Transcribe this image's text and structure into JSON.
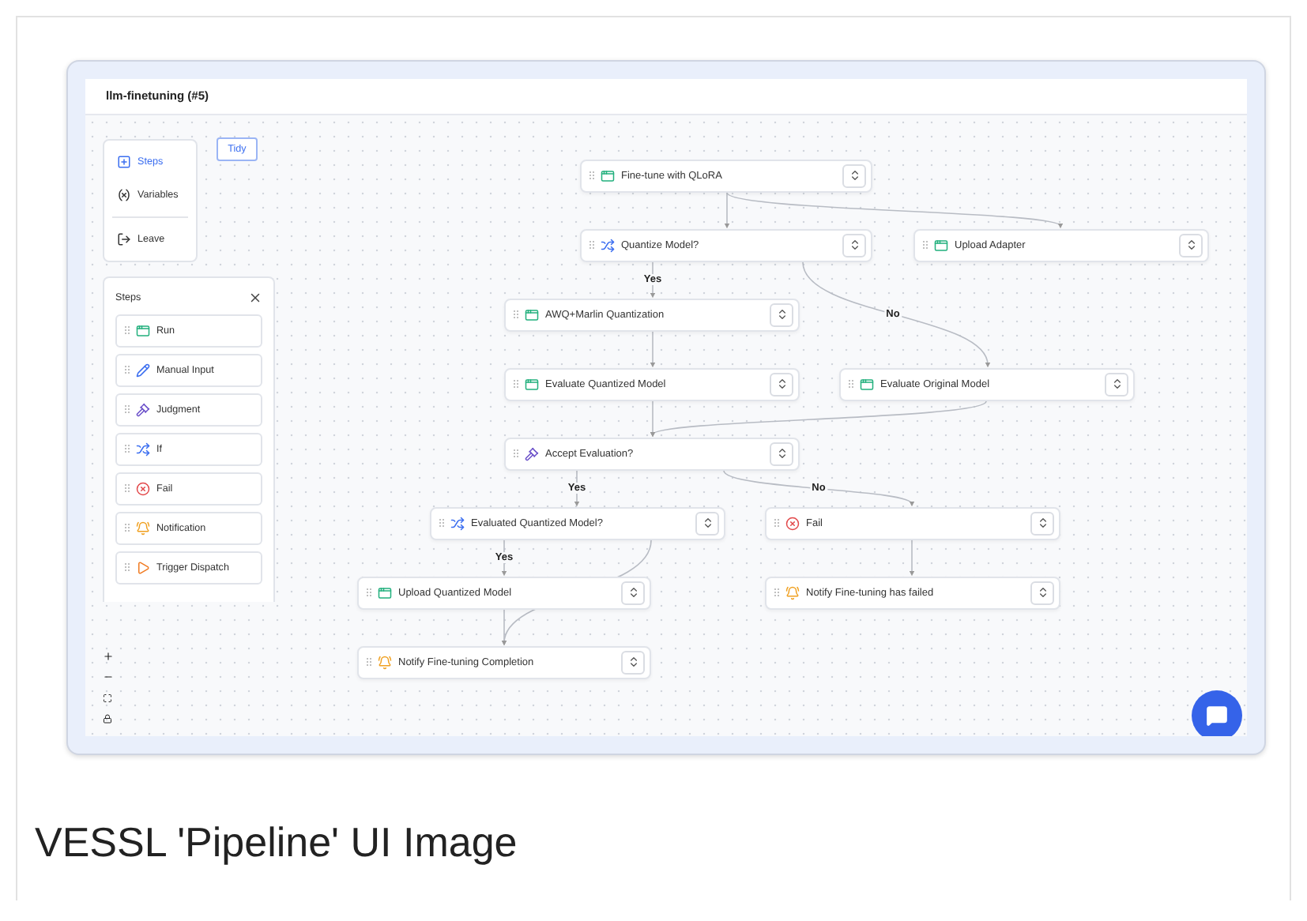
{
  "window": {
    "title": "llm-finetuning (#5)"
  },
  "menu": [
    {
      "label": "Steps",
      "kind": "steps",
      "selected": true
    },
    {
      "label": "Variables",
      "kind": "variables",
      "selected": false
    },
    {
      "label": "Leave",
      "kind": "leave",
      "selected": false
    }
  ],
  "tidy_button": "Tidy",
  "steps_panel": {
    "title": "Steps",
    "items": [
      {
        "label": "Run",
        "kind": "run"
      },
      {
        "label": "Manual Input",
        "kind": "input"
      },
      {
        "label": "Judgment",
        "kind": "judgment"
      },
      {
        "label": "If",
        "kind": "if"
      },
      {
        "label": "Fail",
        "kind": "fail"
      },
      {
        "label": "Notification",
        "kind": "notification"
      },
      {
        "label": "Trigger Dispatch",
        "kind": "trigger"
      }
    ]
  },
  "nodes": [
    {
      "label": "Fine-tune with QLoRA",
      "kind": "run"
    },
    {
      "label": "Quantize Model?",
      "kind": "if"
    },
    {
      "label": "Upload Adapter",
      "kind": "run"
    },
    {
      "label": "AWQ+Marlin Quantization",
      "kind": "run"
    },
    {
      "label": "Evaluate Quantized Model",
      "kind": "run"
    },
    {
      "label": "Evaluate Original Model",
      "kind": "run"
    },
    {
      "label": "Accept Evaluation?",
      "kind": "judgment"
    },
    {
      "label": "Evaluated Quantized Model?",
      "kind": "if"
    },
    {
      "label": "Fail",
      "kind": "fail"
    },
    {
      "label": "Upload Quantized Model",
      "kind": "run"
    },
    {
      "label": "Notify Fine-tuning has failed",
      "kind": "notification"
    },
    {
      "label": "Notify Fine-tuning Completion",
      "kind": "notification"
    }
  ],
  "edge_labels": [
    "Yes",
    "No",
    "Yes",
    "No",
    "Yes"
  ],
  "caption": "VESSL 'Pipeline' UI Image"
}
